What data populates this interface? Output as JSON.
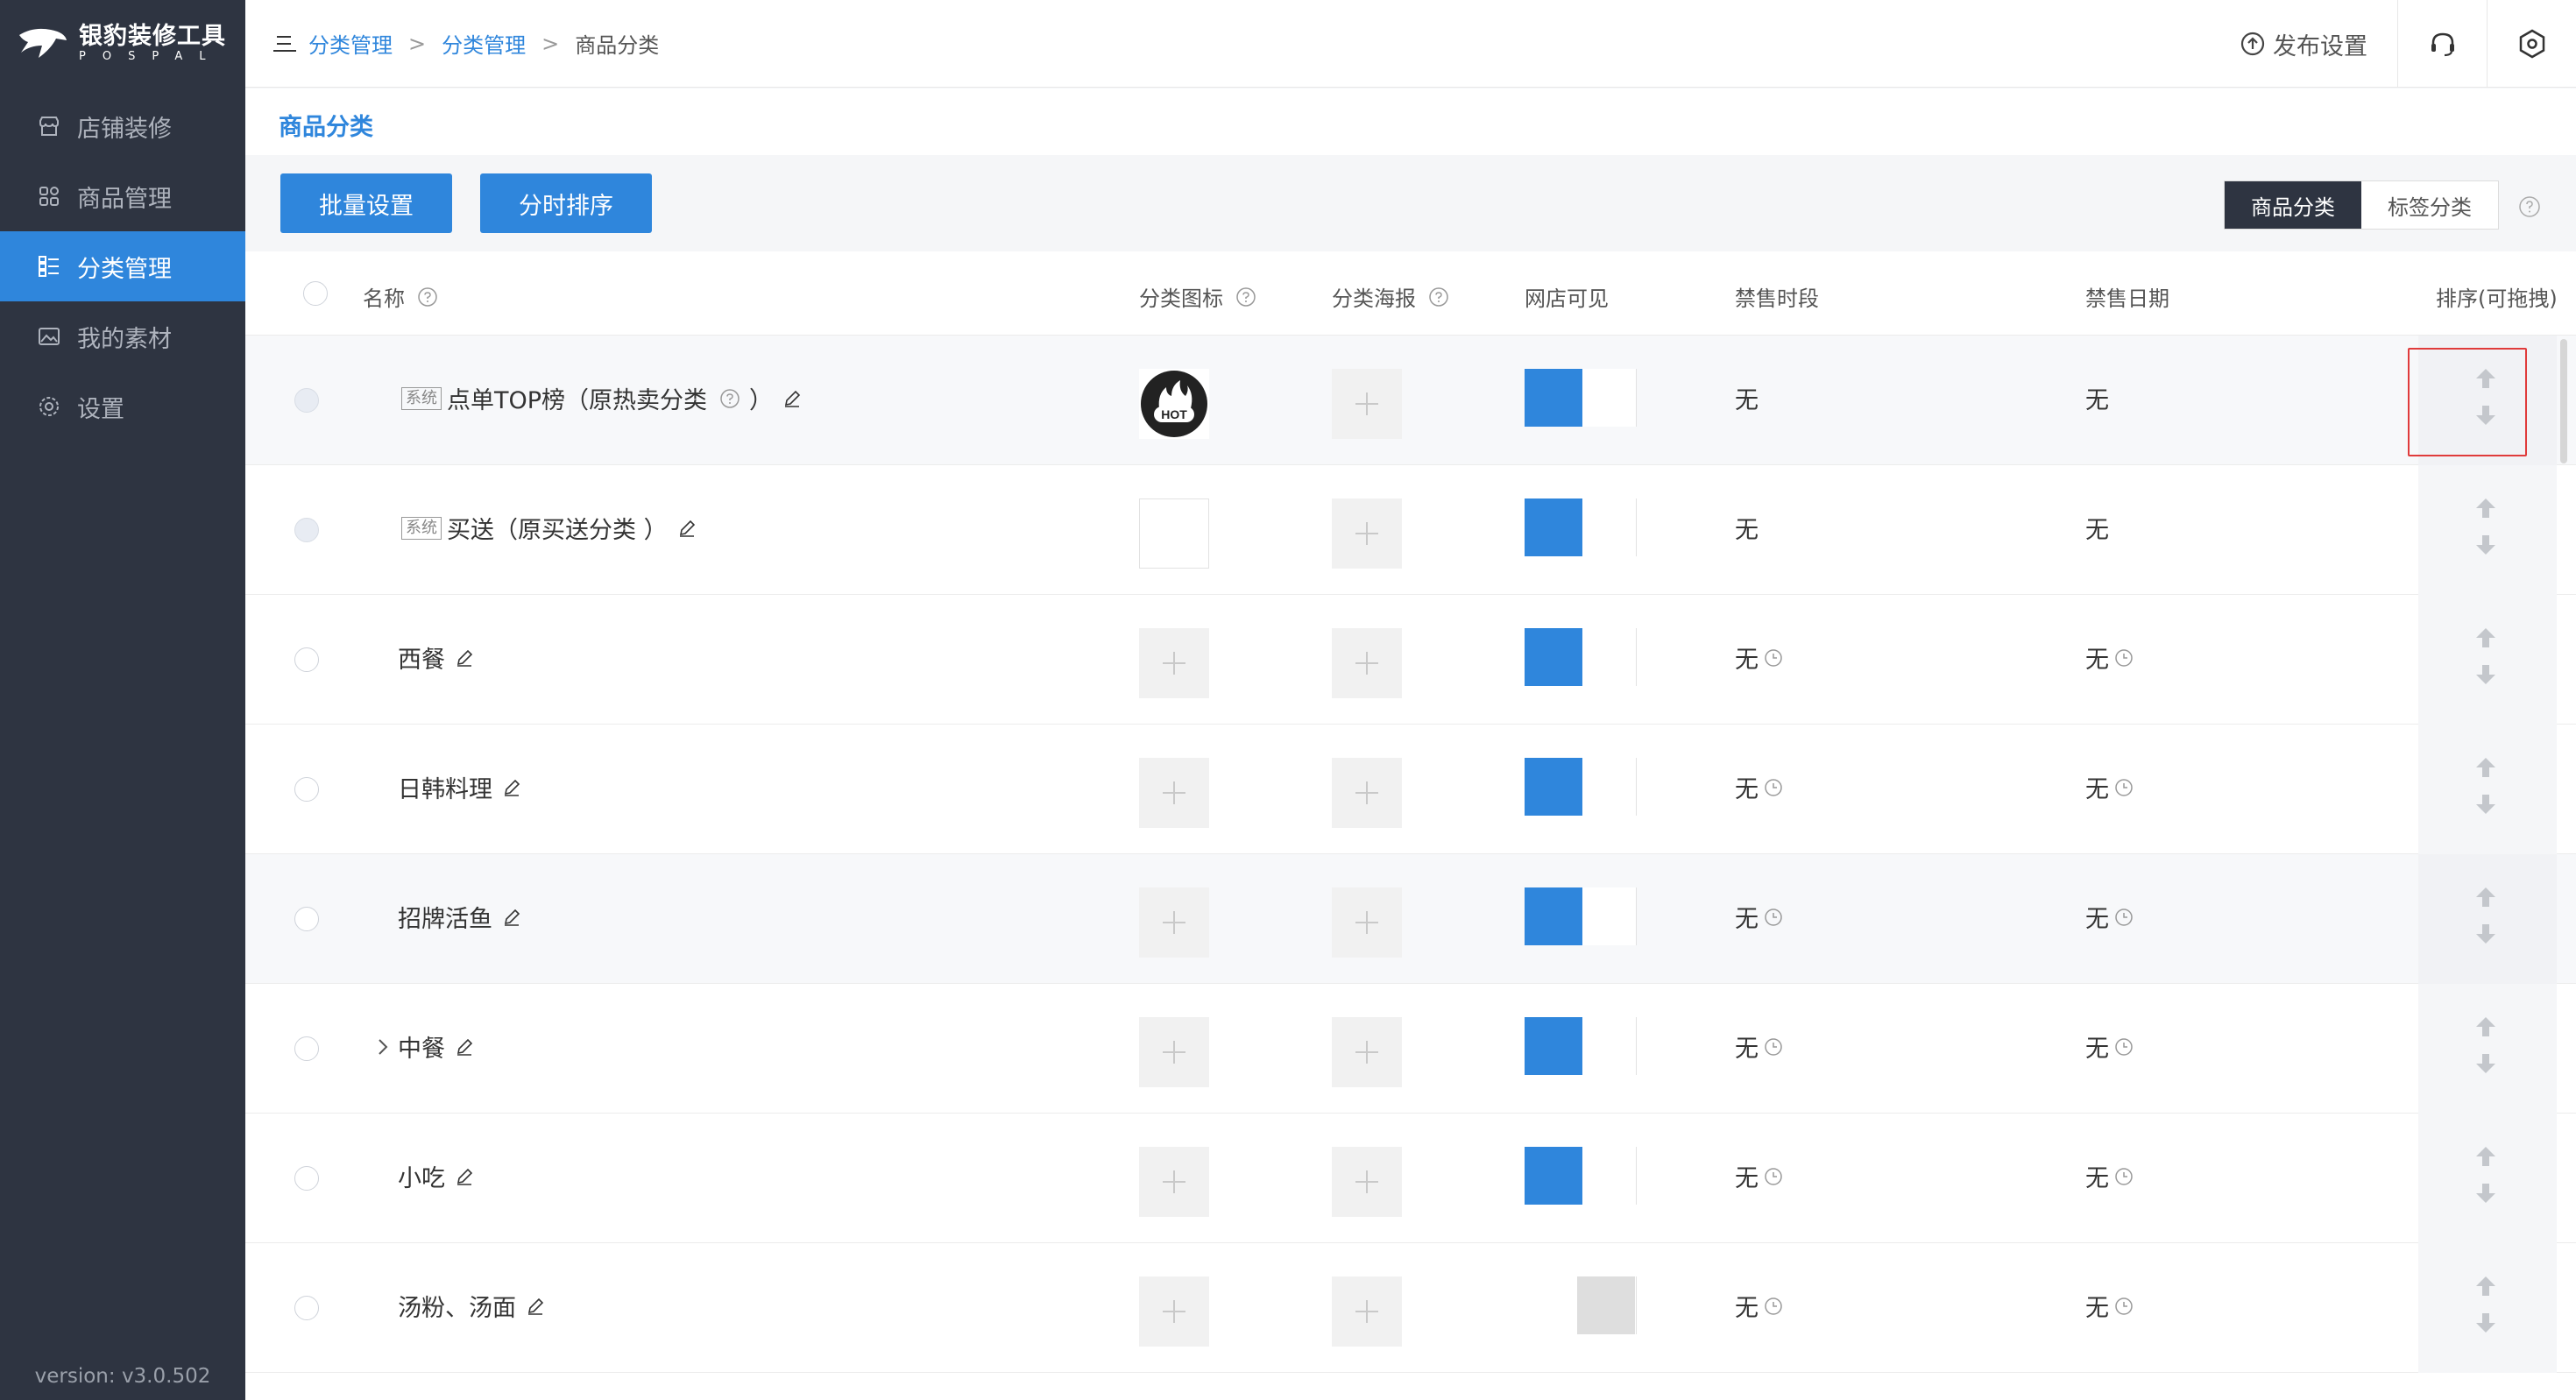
{
  "app": {
    "logo_name": "银豹装修工具",
    "logo_sub": "POSPAL",
    "version": "version: v3.0.502"
  },
  "sidebar": {
    "items": [
      {
        "label": "店铺装修",
        "icon": "store-icon"
      },
      {
        "label": "商品管理",
        "icon": "grid-icon"
      },
      {
        "label": "分类管理",
        "icon": "list-icon",
        "active": true
      },
      {
        "label": "我的素材",
        "icon": "image-icon"
      },
      {
        "label": "设置",
        "icon": "gear-icon"
      }
    ]
  },
  "header": {
    "breadcrumb": [
      "分类管理",
      "分类管理",
      "商品分类"
    ],
    "breadcrumb_sep": ">",
    "publish_label": "发布设置"
  },
  "page": {
    "title": "商品分类"
  },
  "toolbar": {
    "batch_label": "批量设置",
    "timesort_label": "分时排序",
    "seg_product": "商品分类",
    "seg_tag": "标签分类"
  },
  "table": {
    "columns": {
      "name": "名称",
      "icon": "分类图标",
      "poster": "分类海报",
      "visible": "网店可见",
      "ban_time": "禁售时段",
      "ban_date": "禁售日期",
      "sort": "排序(可拖拽)"
    },
    "system_tag": "系统",
    "hot_text": "HOT",
    "rows": [
      {
        "name": "点单TOP榜（原热卖分类",
        "name_suffix": "）",
        "system": true,
        "icon": "hot",
        "visible": true,
        "ban_time": "无",
        "ban_date": "无",
        "clock": false
      },
      {
        "name": "买送（原买送分类 ）",
        "system": true,
        "icon": "empty",
        "visible": true,
        "ban_time": "无",
        "ban_date": "无",
        "clock": false
      },
      {
        "name": "西餐",
        "icon": "plus",
        "visible": true,
        "ban_time": "无",
        "ban_date": "无",
        "clock": true
      },
      {
        "name": "日韩料理",
        "icon": "plus",
        "visible": true,
        "ban_time": "无",
        "ban_date": "无",
        "clock": true
      },
      {
        "name": "招牌活鱼",
        "icon": "plus",
        "visible": true,
        "ban_time": "无",
        "ban_date": "无",
        "clock": true
      },
      {
        "name": "中餐",
        "icon": "plus",
        "expand": true,
        "visible": true,
        "ban_time": "无",
        "ban_date": "无",
        "clock": true
      },
      {
        "name": "小吃",
        "icon": "plus",
        "visible": true,
        "ban_time": "无",
        "ban_date": "无",
        "clock": true
      },
      {
        "name": "汤粉、汤面",
        "icon": "plus",
        "visible": false,
        "ban_time": "无",
        "ban_date": "无",
        "clock": true
      }
    ]
  },
  "colors": {
    "accent": "#2f86dc",
    "sidebar_bg": "#2e3441",
    "highlight": "#e03b3b"
  }
}
